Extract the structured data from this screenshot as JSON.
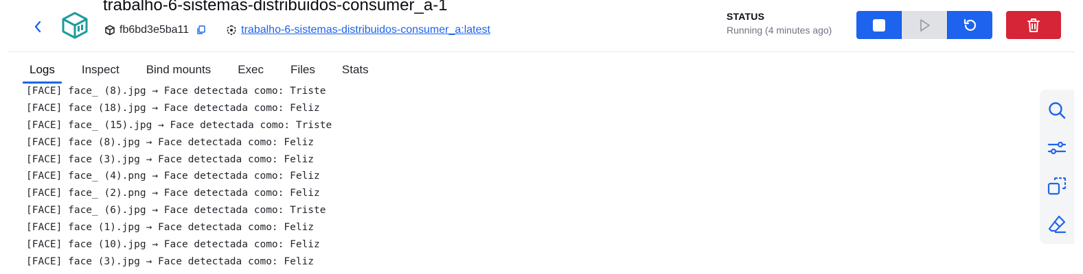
{
  "header": {
    "title": "trabalho-6-sistemas-distribuidos-consumer_a-1",
    "container_id": "fb6bd3e5ba11",
    "image_link": "trabalho-6-sistemas-distribuidos-consumer_a:latest",
    "status_label": "STATUS",
    "status_text": "Running (4 minutes ago)",
    "accent_color": "#1d63ed",
    "danger_color": "#d52536",
    "icon_color": "#1c9c9a"
  },
  "actions": [
    {
      "name": "stop",
      "icon": "stop-icon"
    },
    {
      "name": "start",
      "icon": "play-icon"
    },
    {
      "name": "restart",
      "icon": "restart-icon"
    },
    {
      "name": "delete",
      "icon": "trash-icon"
    }
  ],
  "tabs": [
    {
      "label": "Logs",
      "active": true
    },
    {
      "label": "Inspect",
      "active": false
    },
    {
      "label": "Bind mounts",
      "active": false
    },
    {
      "label": "Exec",
      "active": false
    },
    {
      "label": "Files",
      "active": false
    },
    {
      "label": "Stats",
      "active": false
    }
  ],
  "logs": [
    "[FACE] face_ (8).jpg → Face detectada como: Triste",
    "[FACE] face (18).jpg → Face detectada como: Feliz",
    "[FACE] face_ (15).jpg → Face detectada como: Triste",
    "[FACE] face (8).jpg → Face detectada como: Feliz",
    "[FACE] face (3).jpg → Face detectada como: Feliz",
    "[FACE] face_ (4).png → Face detectada como: Feliz",
    "[FACE] face_ (2).png → Face detectada como: Feliz",
    "[FACE] face_ (6).jpg → Face detectada como: Triste",
    "[FACE] face (1).jpg → Face detectada como: Feliz",
    "[FACE] face (10).jpg → Face detectada como: Feliz",
    "[FACE] face (3).jpg → Face detectada como: Feliz"
  ],
  "side_tools": [
    "search-icon",
    "filter-settings-icon",
    "copy-logs-icon",
    "clear-eraser-icon"
  ]
}
